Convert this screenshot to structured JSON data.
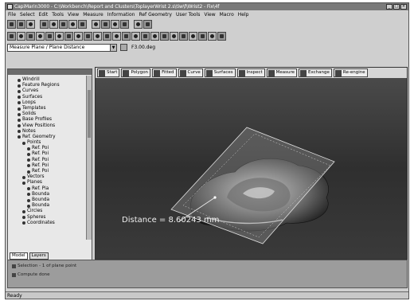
{
  "titlebar": {
    "title": "CapiMarin3000 - C:\\Workbench\\Report and Clusters\\ToplayerWrist 2.s\\tiw\\f\\Wrist2 - Fix\\4f",
    "buttons": [
      "_",
      "□",
      "×"
    ]
  },
  "menu": [
    "File",
    "Select",
    "Edit",
    "Tools",
    "View",
    "Measure",
    "Information",
    "Ref Geometry",
    "User Tools",
    "View",
    "Macro",
    "Help"
  ],
  "selector": {
    "mode": "Measure Plane / Plane Distance",
    "value": "F3.00.deg"
  },
  "tree": {
    "items": [
      {
        "label": "Windrill",
        "level": 0
      },
      {
        "label": "Feature Regions",
        "level": 0
      },
      {
        "label": "Curves",
        "level": 0
      },
      {
        "label": "Surfaces",
        "level": 0
      },
      {
        "label": "Loops",
        "level": 0
      },
      {
        "label": "Templates",
        "level": 0
      },
      {
        "label": "Solids",
        "level": 0
      },
      {
        "label": "Base Profiles",
        "level": 0
      },
      {
        "label": "View Positions",
        "level": 0
      },
      {
        "label": "Notes",
        "level": 0
      },
      {
        "label": "Ref. Geometry",
        "level": 0
      },
      {
        "label": "Points",
        "level": 1
      },
      {
        "label": "Ref. Poi",
        "level": 2
      },
      {
        "label": "Ref. Poi",
        "level": 2
      },
      {
        "label": "Ref. Poi",
        "level": 2
      },
      {
        "label": "Ref. Poi",
        "level": 2
      },
      {
        "label": "Ref. Poi",
        "level": 2
      },
      {
        "label": "Vectors",
        "level": 1
      },
      {
        "label": "Planes",
        "level": 1
      },
      {
        "label": "Ref. Pla",
        "level": 2
      },
      {
        "label": "Bounda",
        "level": 2
      },
      {
        "label": "Bounda",
        "level": 2
      },
      {
        "label": "Bounda",
        "level": 2
      },
      {
        "label": "Circles",
        "level": 1
      },
      {
        "label": "Spheres",
        "level": 1
      },
      {
        "label": "Coordinates",
        "level": 1
      }
    ],
    "tabs": [
      "Model",
      "Layers"
    ]
  },
  "view_tabs": [
    "Start",
    "Polygon",
    "Fitted",
    "Curve",
    "Surfaces",
    "Inspect",
    "Measure",
    "Exchange",
    "Re-engine"
  ],
  "viewport": {
    "distance_label": "Distance = 8.60243 mm"
  },
  "output": {
    "lines": [
      "Selection - 1 of plane point",
      "Compute done"
    ]
  },
  "status": {
    "text": "Ready"
  }
}
